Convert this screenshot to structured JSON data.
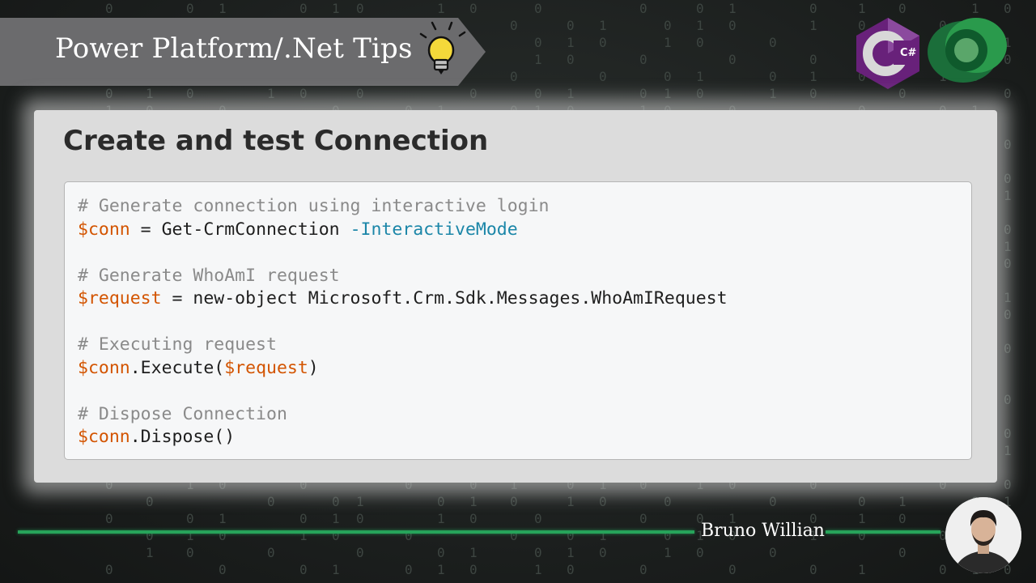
{
  "banner": {
    "title": "Power Platform/.Net Tips",
    "icon": "lightbulb-icon",
    "color": "#6b6b6d"
  },
  "logos": {
    "csharp": {
      "label": "C#",
      "icon": "csharp-logo",
      "color": "#68217a"
    },
    "dataverse": {
      "icon": "dataverse-logo",
      "color": "#1f8a3f"
    }
  },
  "card": {
    "title": "Create and test Connection"
  },
  "code": {
    "lines": [
      [
        {
          "t": "cmt",
          "v": "# Generate connection using interactive login"
        }
      ],
      [
        {
          "t": "var",
          "v": "$conn"
        },
        {
          "t": "txt",
          "v": " = Get-CrmConnection "
        },
        {
          "t": "par",
          "v": "-InteractiveMode"
        }
      ],
      [],
      [
        {
          "t": "cmt",
          "v": "# Generate WhoAmI request"
        }
      ],
      [
        {
          "t": "var",
          "v": "$request"
        },
        {
          "t": "txt",
          "v": " = new-object Microsoft.Crm.Sdk.Messages.WhoAmIRequest"
        }
      ],
      [],
      [
        {
          "t": "cmt",
          "v": "# Executing request"
        }
      ],
      [
        {
          "t": "var",
          "v": "$conn"
        },
        {
          "t": "txt",
          "v": ".Execute("
        },
        {
          "t": "var",
          "v": "$request"
        },
        {
          "t": "txt",
          "v": ")"
        }
      ],
      [],
      [
        {
          "t": "cmt",
          "v": "# Dispose Connection"
        }
      ],
      [
        {
          "t": "var",
          "v": "$conn"
        },
        {
          "t": "txt",
          "v": ".Dispose()"
        }
      ]
    ],
    "colors": {
      "comment": "#8a8a8a",
      "variable": "#d35400",
      "parameter": "#1b86a8"
    }
  },
  "footer": {
    "author": "Bruno Willian",
    "avatar_icon": "author-avatar",
    "line_color": "#27a35a"
  }
}
